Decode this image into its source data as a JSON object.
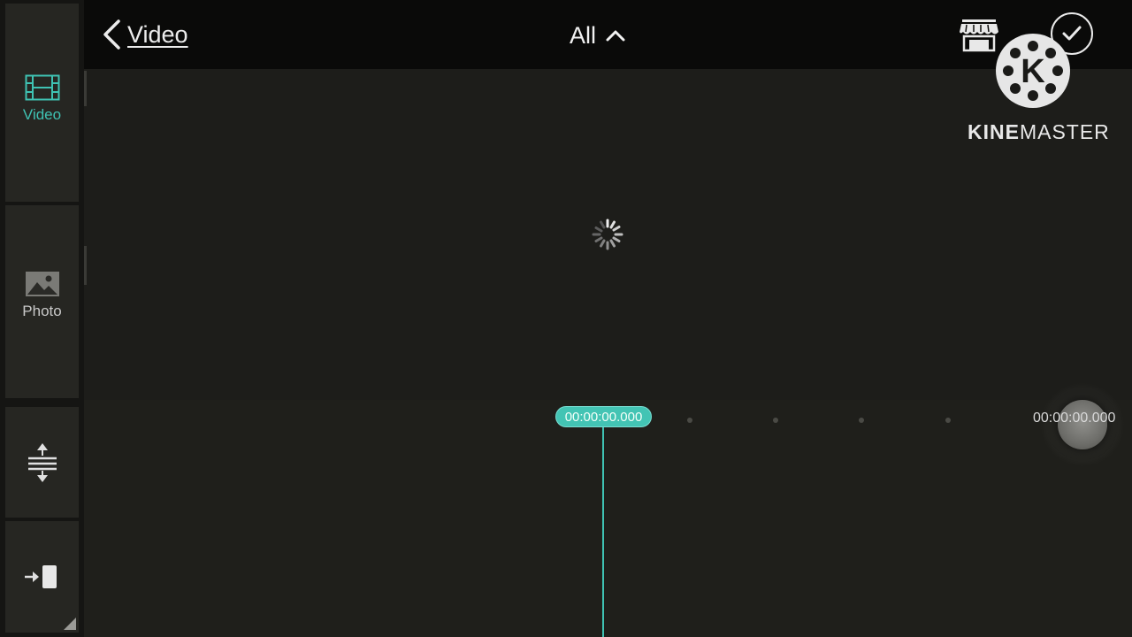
{
  "header": {
    "back_label": "Video",
    "filter_label": "All"
  },
  "sidebar": {
    "tabs": [
      {
        "label": "Video",
        "icon": "film-icon",
        "active": true
      },
      {
        "label": "Photo",
        "icon": "image-icon",
        "active": false
      }
    ],
    "tools": [
      {
        "icon": "expand-vertical-icon"
      },
      {
        "icon": "insert-clip-icon"
      }
    ]
  },
  "timeline": {
    "playhead_time": "00:00:00.000",
    "end_time": "00:00:00.000"
  },
  "watermark": {
    "brand_bold": "KINE",
    "brand_rest": "MASTER",
    "logo_letter": "K"
  },
  "colors": {
    "accent": "#3fc2b3",
    "background": "#1b1b18",
    "topbar": "#0a0a09"
  }
}
